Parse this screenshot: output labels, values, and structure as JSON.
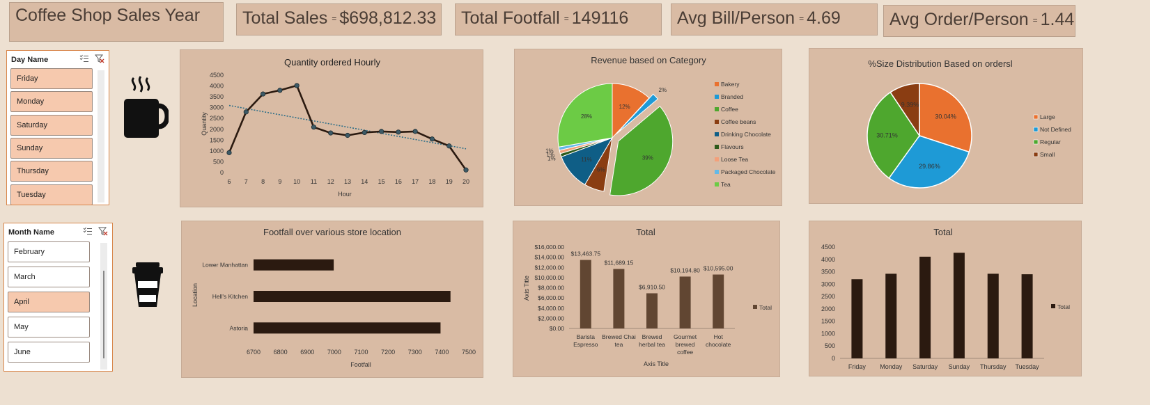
{
  "dashboard_title": "Coffee Shop Sales  Year",
  "kpis": {
    "total_sales_label": "Total Sales",
    "total_sales_value": "$698,812.33",
    "total_footfall_label": "Total Footfall",
    "total_footfall_value": "149116",
    "avg_bill_label": "Avg Bill/Person",
    "avg_bill_value": "4.69",
    "avg_order_label": "Avg Order/Person",
    "avg_order_value": "1.44",
    "separator": "="
  },
  "day_slicer": {
    "title": "Day Name",
    "items": [
      {
        "label": "Friday",
        "selected": true
      },
      {
        "label": "Monday",
        "selected": true
      },
      {
        "label": "Saturday",
        "selected": true
      },
      {
        "label": "Sunday",
        "selected": true
      },
      {
        "label": "Thursday",
        "selected": true
      },
      {
        "label": "Tuesday",
        "selected": true
      }
    ]
  },
  "month_slicer": {
    "title": "Month Name",
    "items": [
      {
        "label": "February",
        "selected": false
      },
      {
        "label": "March",
        "selected": false
      },
      {
        "label": "April",
        "selected": true
      },
      {
        "label": "May",
        "selected": false
      },
      {
        "label": "June",
        "selected": false
      }
    ]
  },
  "icons": {
    "hot_coffee": "hot-coffee-mug-icon",
    "takeaway": "takeaway-coffee-cup-icon",
    "multi_select": "multi-select-icon",
    "clear_filter": "clear-filter-icon"
  },
  "colors": {
    "background": "#EDE0D1",
    "panel": "#D9BBA4",
    "dark_brown": "#2B1A10",
    "bar_brown": "#614632",
    "slicer_selected": "#F6C9AE",
    "slicer_border": "#D8874C"
  },
  "chart_data": [
    {
      "id": "hourly",
      "type": "line",
      "title": "Quantity ordered Hourly",
      "xlabel": "Hour",
      "ylabel": "Quantity",
      "x": [
        6,
        7,
        8,
        9,
        10,
        11,
        12,
        13,
        14,
        15,
        16,
        17,
        18,
        19,
        20
      ],
      "values": [
        920,
        2800,
        3630,
        3800,
        4020,
        2100,
        1830,
        1720,
        1850,
        1900,
        1870,
        1900,
        1550,
        1230,
        120
      ],
      "trendline": {
        "type": "linear",
        "start": 3100,
        "end": 1100
      },
      "yticks": [
        0,
        500,
        1000,
        1500,
        2000,
        2500,
        3000,
        3500,
        4000,
        4500
      ],
      "ylim": [
        0,
        4500
      ],
      "grid": false
    },
    {
      "id": "category",
      "type": "pie",
      "title": "Revenue based on Category",
      "legend_position": "right",
      "categories": [
        "Bakery",
        "Branded",
        "Coffee",
        "Coffee beans",
        "Drinking Chocolate",
        "Flavours",
        "Loose Tea",
        "Packaged Chocolate",
        "Tea"
      ],
      "values": [
        12,
        2,
        39,
        6,
        11,
        1,
        1,
        1,
        28
      ],
      "colors": [
        "#E9712F",
        "#1E9AD6",
        "#4EA72E",
        "#8A3D12",
        "#0F5E86",
        "#2E5A1B",
        "#F3A07A",
        "#62B9E8",
        "#6CCB45"
      ],
      "labels": [
        "12%",
        "2%",
        "39%",
        "6%",
        "11%",
        "1%",
        "1%",
        "1%",
        "28%"
      ]
    },
    {
      "id": "size",
      "type": "pie",
      "title": "%Size Distribution Based on ordersl",
      "legend_position": "right",
      "categories": [
        "Large",
        "Not Defined",
        "Regular",
        "Small"
      ],
      "values": [
        30.04,
        29.86,
        30.71,
        9.39
      ],
      "order_clockwise": [
        "Large",
        "Not Defined",
        "Regular",
        "Small"
      ],
      "colors": [
        "#E9712F",
        "#1E9AD6",
        "#4EA72E",
        "#8A3D12"
      ],
      "labels": [
        "30.04%",
        "29.86%",
        "30.71%",
        "9.39%"
      ]
    },
    {
      "id": "location",
      "type": "bar",
      "orientation": "horizontal",
      "title": "Footfall over various store location",
      "xlabel": "Footfall",
      "ylabel": "Location",
      "categories": [
        "Lower Manhattan",
        "Hell's Kitchen",
        "Astoria"
      ],
      "values": [
        6998,
        7432,
        7395
      ],
      "xlim": [
        6700,
        7500
      ],
      "xticks": [
        6700,
        6800,
        6900,
        7000,
        7100,
        7200,
        7300,
        7400,
        7500
      ]
    },
    {
      "id": "products",
      "type": "bar",
      "title": "Total",
      "xlabel": "Axis Title",
      "ylabel": "Axis Title",
      "categories": [
        [
          "Barista",
          "Espresso"
        ],
        [
          "Brewed Chai",
          "tea"
        ],
        [
          "Brewed",
          "herbal tea"
        ],
        [
          "Gourmet",
          "brewed",
          "coffee"
        ],
        [
          "Hot",
          "chocolate"
        ]
      ],
      "values": [
        13463.75,
        11689.15,
        6910.5,
        10194.8,
        10595.0
      ],
      "data_labels": [
        "$13,463.75",
        "$11,689.15",
        "$6,910.50",
        "$10,194.80",
        "$10,595.00"
      ],
      "yticks": [
        "$0.00",
        "$2,000.00",
        "$4,000.00",
        "$6,000.00",
        "$8,000.00",
        "$10,000.00",
        "$12,000.00",
        "$14,000.00",
        "$16,000.00"
      ],
      "ylim": [
        0,
        16000
      ],
      "legend": "Total",
      "legend_position": "right"
    },
    {
      "id": "weekday",
      "type": "bar",
      "title": "Total",
      "categories": [
        "Friday",
        "Monday",
        "Saturday",
        "Sunday",
        "Thursday",
        "Tuesday"
      ],
      "values": [
        3200,
        3420,
        4110,
        4270,
        3420,
        3400
      ],
      "yticks": [
        0,
        500,
        1000,
        1500,
        2000,
        2500,
        3000,
        3500,
        4000,
        4500
      ],
      "ylim": [
        0,
        4500
      ],
      "legend": "Total",
      "legend_position": "right"
    }
  ]
}
